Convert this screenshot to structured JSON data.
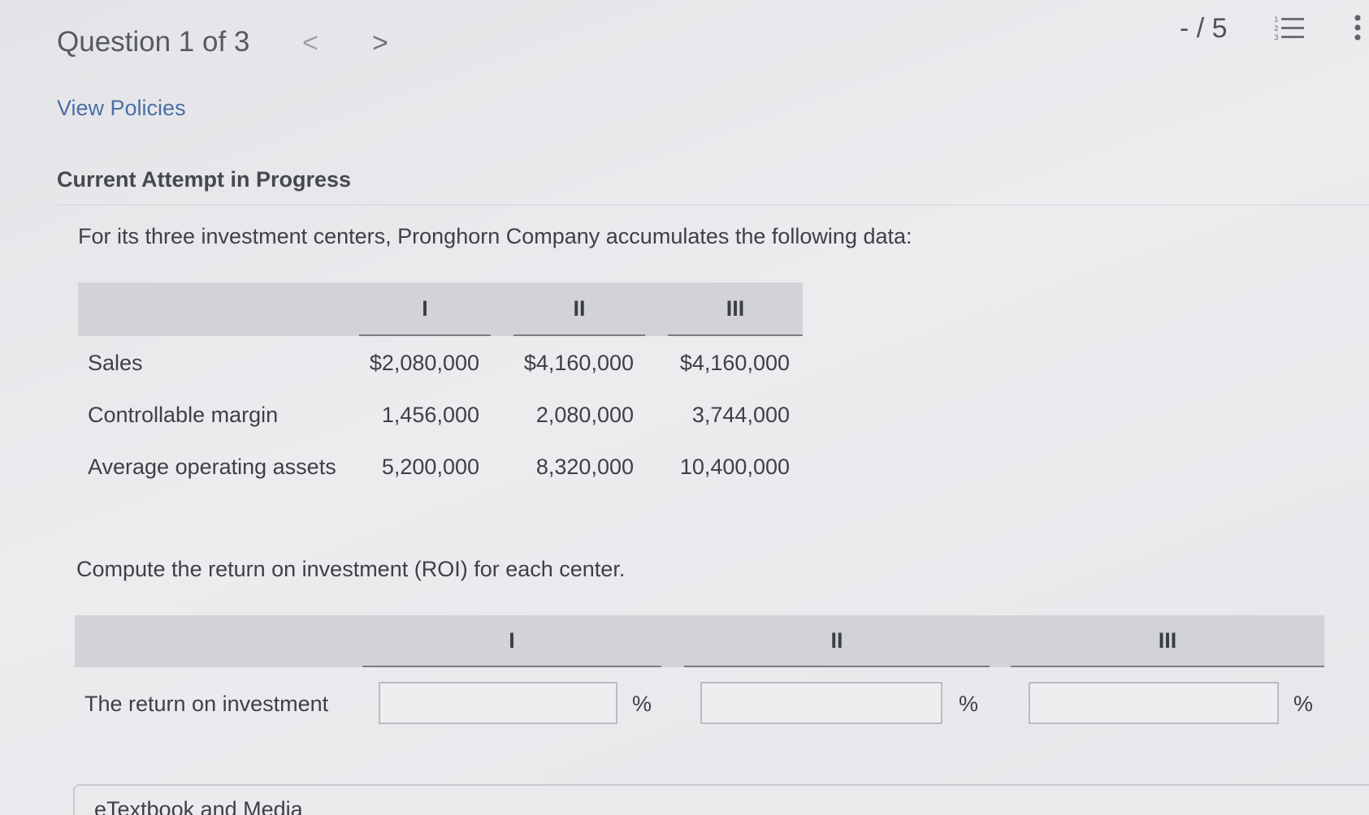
{
  "header": {
    "question_title": "Question 1 of 3",
    "prev_symbol": "<",
    "next_symbol": ">",
    "score": "- / 5"
  },
  "view_policies_label": "View Policies",
  "attempt_heading": "Current Attempt in Progress",
  "intro_text": "For its three investment centers, Pronghorn Company accumulates the following data:",
  "data_table": {
    "columns": [
      "I",
      "II",
      "III"
    ],
    "rows": [
      {
        "label": "Sales",
        "values": [
          "$2,080,000",
          "$4,160,000",
          "$4,160,000"
        ]
      },
      {
        "label": "Controllable margin",
        "values": [
          "1,456,000",
          "2,080,000",
          "3,744,000"
        ]
      },
      {
        "label": "Average operating assets",
        "values": [
          "5,200,000",
          "8,320,000",
          "10,400,000"
        ]
      }
    ]
  },
  "compute_text": "Compute the return on investment (ROI) for each center.",
  "answer_table": {
    "columns": [
      "I",
      "II",
      "III"
    ],
    "row_label": "The return on investment",
    "inputs": [
      "",
      "",
      ""
    ],
    "unit": "%"
  },
  "etextbook_label": "eTextbook and Media",
  "icons": {
    "list": "numbered-list-icon",
    "more": "vertical-ellipsis-icon"
  }
}
